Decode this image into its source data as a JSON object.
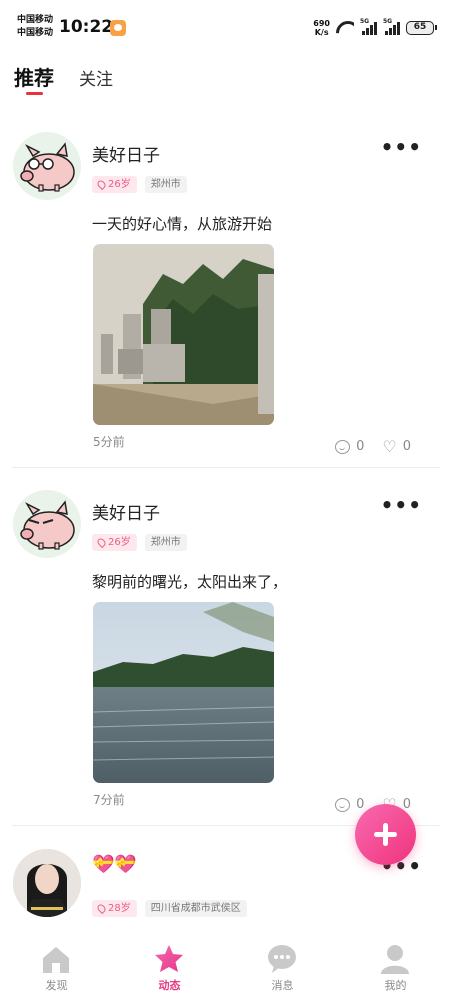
{
  "status_bar": {
    "carrier_1": "中国移动",
    "carrier_2": "中国移动",
    "time": "10:22",
    "net_speed_value": "690",
    "net_speed_unit": "K/s",
    "signal_1": "5G",
    "signal_2": "5G",
    "battery": "65"
  },
  "top_tabs": [
    {
      "label": "推荐",
      "active": true
    },
    {
      "label": "关注",
      "active": false
    }
  ],
  "posts": [
    {
      "username": "美好日子",
      "age": "26岁",
      "city": "郑州市",
      "text": "一天的好心情，从旅游开始",
      "time": "5分前",
      "comments": "0",
      "likes": "0",
      "photo_icon": "stone-statues-photo"
    },
    {
      "username": "美好日子",
      "age": "26岁",
      "city": "郑州市",
      "text": "黎明前的曙光，太阳出来了，",
      "time": "7分前",
      "comments": "0",
      "likes": "0",
      "photo_icon": "lake-photo"
    },
    {
      "username": "💝💝",
      "age": "28岁",
      "city": "四川省成都市武侯区"
    }
  ],
  "bottom_nav": [
    {
      "label": "发现",
      "icon": "home-icon",
      "active": false
    },
    {
      "label": "动态",
      "icon": "star-icon",
      "active": true
    },
    {
      "label": "消息",
      "icon": "chat-icon",
      "active": false
    },
    {
      "label": "我的",
      "icon": "person-icon",
      "active": false
    }
  ],
  "colors": {
    "accent": "#f0337c",
    "tab_indicator": "#e8303e",
    "age_badge_text": "#f05a84"
  }
}
